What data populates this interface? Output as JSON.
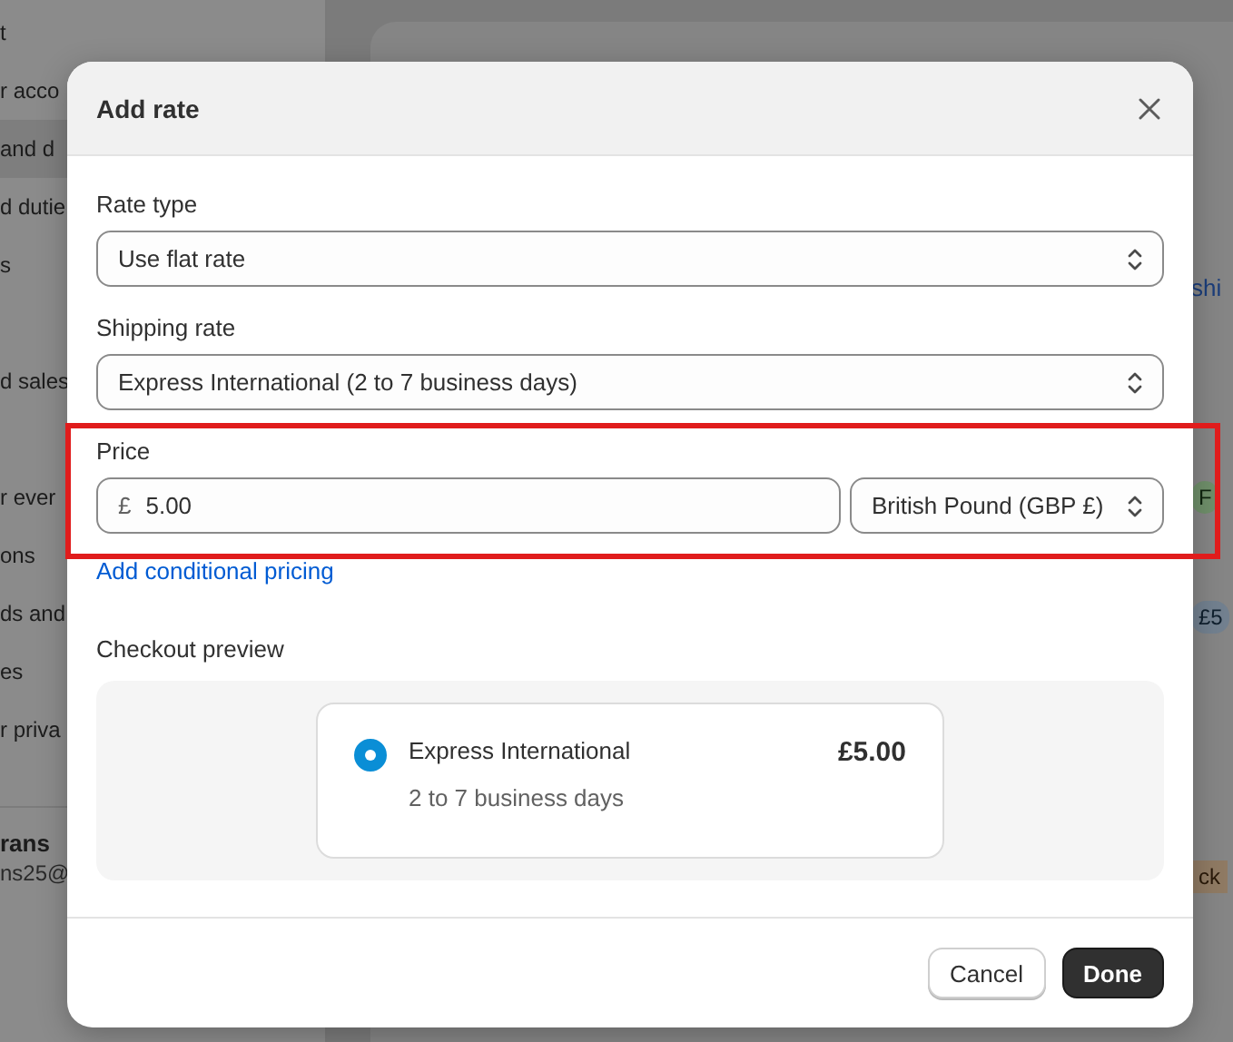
{
  "background": {
    "sidebar": {
      "groups": [
        [
          {
            "label": "t",
            "selected": false
          },
          {
            "label": "r acco",
            "selected": false
          },
          {
            "label": "and d",
            "selected": true
          },
          {
            "label": "d dutie",
            "selected": false
          },
          {
            "label": "s",
            "selected": false
          }
        ],
        [
          {
            "label": "d sales",
            "selected": false
          }
        ],
        [
          {
            "label": "r ever",
            "selected": false
          },
          {
            "label": "ons",
            "selected": false
          },
          {
            "label": "ds and",
            "selected": false
          },
          {
            "label": "es",
            "selected": false
          },
          {
            "label": "r priva",
            "selected": false
          }
        ]
      ],
      "account": {
        "name": "rans",
        "email": "ns25@"
      }
    },
    "main": {
      "rows": [
        {
          "kind": "link",
          "text": "shi"
        },
        {
          "kind": "success_badge",
          "text": "F"
        },
        {
          "kind": "info_badge",
          "text": "£5"
        },
        {
          "kind": "attention_badge",
          "text": "ck"
        }
      ]
    }
  },
  "dialog": {
    "title": "Add rate",
    "fields": [
      {
        "kind": "select",
        "label": "Rate type",
        "value": "Use flat rate"
      },
      {
        "kind": "select",
        "label": "Shipping rate",
        "value": "Express International (2 to 7 business days)"
      },
      {
        "kind": "price",
        "label": "Price",
        "prefix": "£",
        "value": "5.00",
        "currency": "British Pound (GBP £)",
        "highlighted": true
      }
    ],
    "link": "Add conditional pricing",
    "preview": {
      "title": "Checkout preview",
      "option": {
        "name": "Express International",
        "detail": "2 to 7 business days",
        "price": "£5.00",
        "selected": true
      }
    },
    "buttons": [
      {
        "label": "Cancel",
        "kind": "secondary"
      },
      {
        "label": "Done",
        "kind": "primary"
      }
    ]
  }
}
